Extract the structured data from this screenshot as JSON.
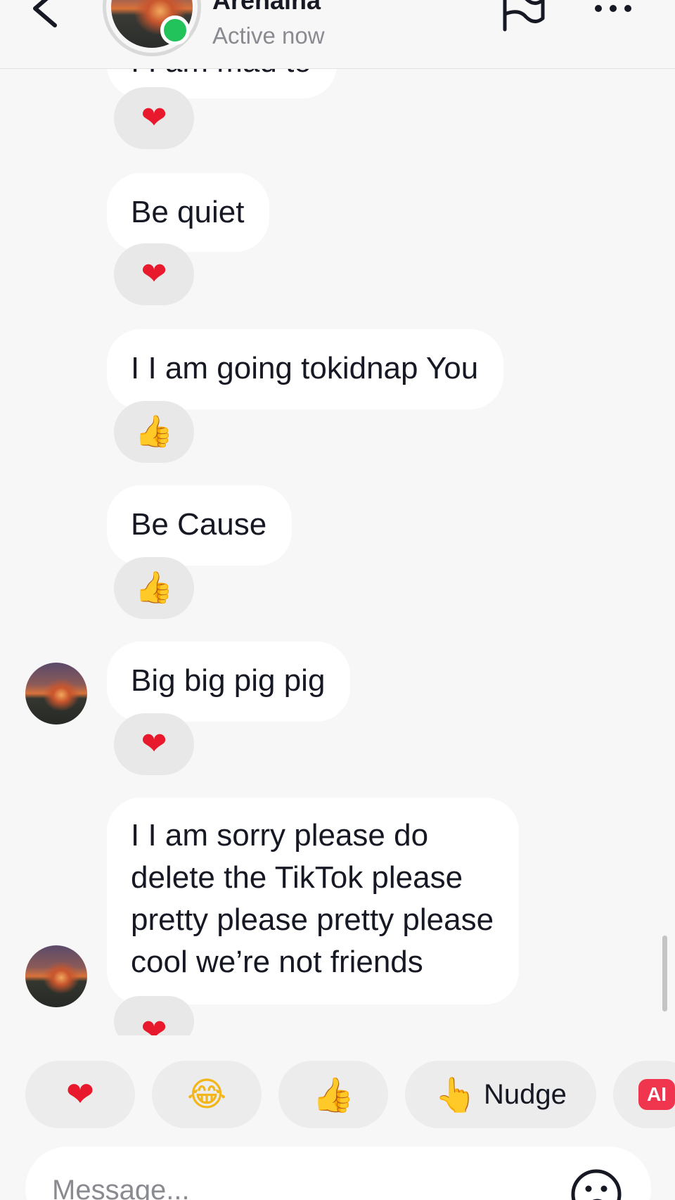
{
  "header": {
    "contact_name": "Arenaina",
    "status": "Active now"
  },
  "messages": [
    {
      "text": "I I am mad to",
      "reaction": "heart"
    },
    {
      "text": "Be quiet",
      "reaction": "heart"
    },
    {
      "text": "I I am going tokidnap You",
      "reaction": "thumbs-up"
    },
    {
      "text": "Be Cause",
      "reaction": "thumbs-up"
    },
    {
      "text": "Big big pig pig",
      "reaction": "heart",
      "avatar": true
    },
    {
      "lines": [
        "I I am sorry please do",
        "delete the TikTok please",
        "pretty please pretty please",
        "cool we’re not friends"
      ],
      "reaction": "heart",
      "avatar": true
    }
  ],
  "quick_reactions": {
    "heart": "❤",
    "laugh": "😂",
    "thumbs_up": "👍",
    "nudge_emoji": "👆",
    "nudge_label": "Nudge",
    "ai_label": "AI"
  },
  "composer": {
    "placeholder": "Message..."
  },
  "colors": {
    "background": "#f7f7f7",
    "bubble": "#ffffff",
    "reaction_pill": "#e8e8e8",
    "online": "#21c35a",
    "heart": "#e8192c",
    "ai_badge": "#f0364f"
  },
  "icons": {
    "back": "chevron-left-icon",
    "report": "flag-icon",
    "more": "more-horizontal-icon",
    "emoji": "emoji-face-icon"
  }
}
